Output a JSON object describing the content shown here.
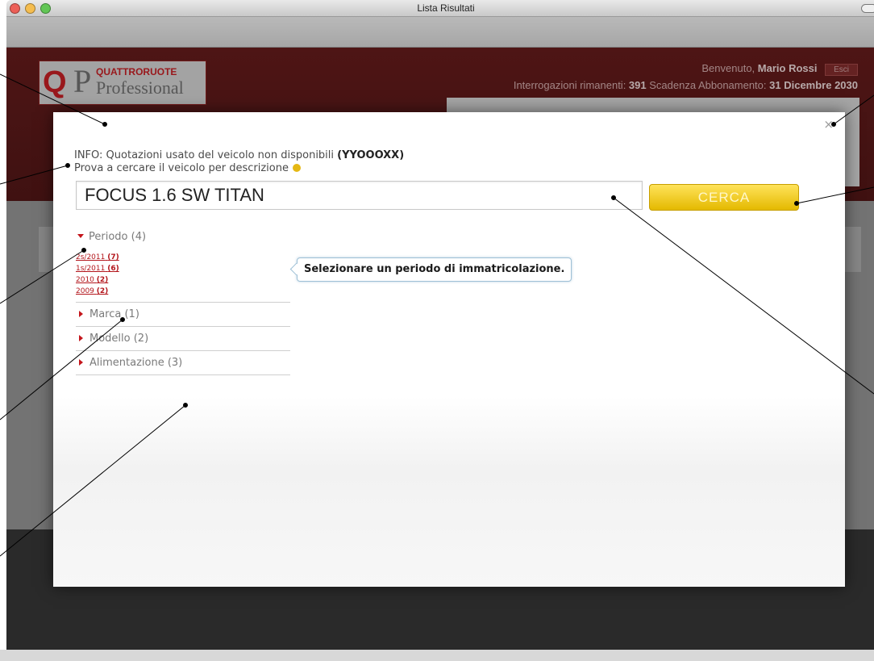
{
  "window": {
    "title": "Lista Risultati",
    "controls": {
      "close_color": "#ec5f57",
      "minimize_color": "#f5bd4f",
      "zoom_color": "#62c655"
    }
  },
  "header": {
    "logo": {
      "letter": "Q",
      "initial": "P",
      "brand": "QUATTRORUOTE",
      "product": "Professional"
    },
    "welcome_prefix": "Benvenuto, ",
    "user_name": "Mario Rossi",
    "exit_label": "Esci",
    "queries_label": "Interrogazioni rimanenti: ",
    "queries_value": "391",
    "expiry_label": " Scadenza Abbonamento: ",
    "expiry_value": "31 Dicembre 2030"
  },
  "dialog": {
    "close_label": "×",
    "info_text": "INFO: Quotazioni usato del veicolo non disponibili ",
    "info_code": "(YYOOOXX)",
    "hint_text": "Prova a cercare il veicolo per descrizione",
    "search_value": "FOCUS 1.6 SW TITAN",
    "search_button": "CERCA",
    "tooltip": "Selezionare un periodo di immatricolazione.",
    "filters": {
      "periodo": {
        "label": "Periodo (4)",
        "items": [
          {
            "label": "2s/2011",
            "count": "(7)"
          },
          {
            "label": "1s/2011",
            "count": "(6)"
          },
          {
            "label": "2010",
            "count": "(2)"
          },
          {
            "label": "2009",
            "count": "(2)"
          }
        ]
      },
      "marca": {
        "label": "Marca (1)"
      },
      "modello": {
        "label": "Modello (2)"
      },
      "alimentazione": {
        "label": "Alimentazione (3)"
      }
    }
  },
  "colors": {
    "accent_red": "#c4161c",
    "header_red": "#5e1212",
    "button_yellow": "#f0c400"
  }
}
